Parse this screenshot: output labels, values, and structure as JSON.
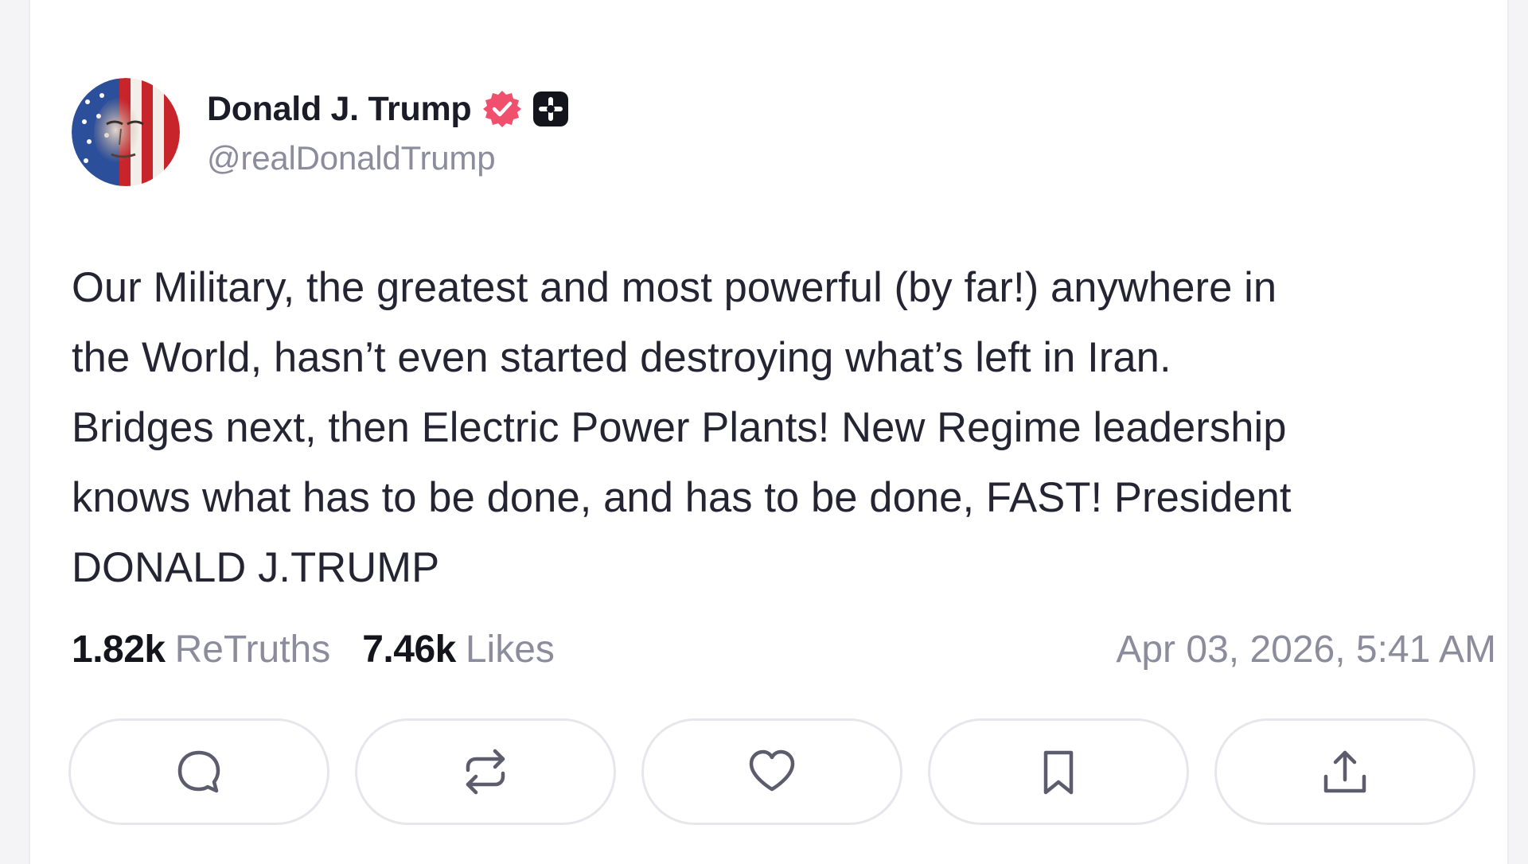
{
  "post": {
    "author": {
      "display_name": "Donald J. Trump",
      "handle": "@realDonaldTrump",
      "verified_color": "#f0506e",
      "badge_icon": "plus-badge-icon"
    },
    "text": "Our Military, the greatest and most powerful (by far!) anywhere in\nthe World, hasn’t even started destroying what’s left in Iran.\nBridges next, then Electric Power Plants! New Regime leadership\nknows what has to be done, and has to be done, FAST! President\nDONALD J.TRUMP",
    "stats": {
      "retruths_count": "1.82k",
      "retruths_label": "ReTruths",
      "likes_count": "7.46k",
      "likes_label": "Likes"
    },
    "timestamp": "Apr 03, 2026, 5:41 AM"
  },
  "actions": [
    {
      "name": "reply",
      "icon": "speech-bubble-icon"
    },
    {
      "name": "retruth",
      "icon": "repost-arrows-icon"
    },
    {
      "name": "like",
      "icon": "heart-icon"
    },
    {
      "name": "bookmark",
      "icon": "bookmark-icon"
    },
    {
      "name": "share",
      "icon": "share-upload-icon"
    }
  ],
  "colors": {
    "text_primary": "#242432",
    "text_secondary": "#8c8c9c",
    "border": "#e6e6ec"
  }
}
